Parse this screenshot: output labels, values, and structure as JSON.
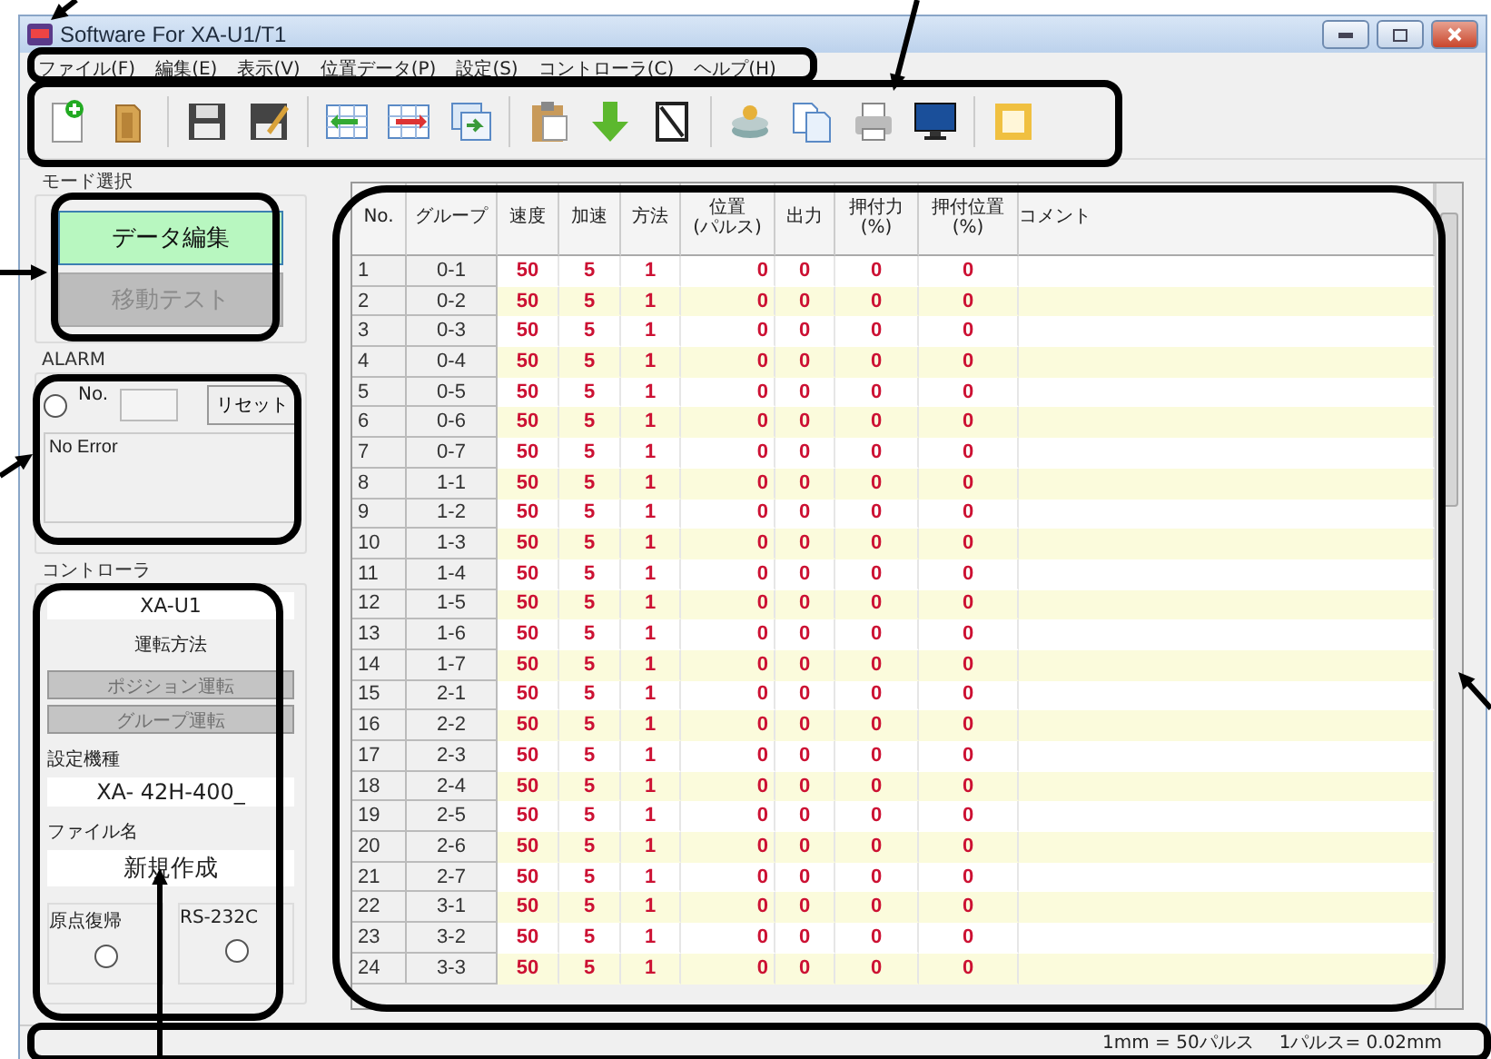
{
  "window": {
    "title": "Software For XA-U1/T1"
  },
  "menu": [
    "ファイル(F)",
    "編集(E)",
    "表示(V)",
    "位置データ(P)",
    "設定(S)",
    "コントローラ(C)",
    "ヘルプ(H)"
  ],
  "mode": {
    "label": "モード選択",
    "buttons": [
      {
        "label": "データ編集",
        "selected": true,
        "disabled": false
      },
      {
        "label": "移動テスト",
        "selected": false,
        "disabled": true
      }
    ]
  },
  "alarm": {
    "label": "ALARM",
    "lamp_on": false,
    "no_label": "No.",
    "reset": "リセット",
    "message": "No Error"
  },
  "controller": {
    "label": "コントローラ",
    "model": "XA-U1",
    "operation_label": "運転方法",
    "operations": [
      {
        "label": "ポジション運転",
        "disabled": true
      },
      {
        "label": "グループ運転",
        "disabled": true
      }
    ],
    "type_label": "設定機種",
    "type_value": "XA- 42H-400_",
    "file_label": "ファイル名",
    "file_value": "新規作成",
    "lamps": [
      {
        "label": "原点復帰",
        "on": false
      },
      {
        "label": "RS-232C",
        "on": false
      }
    ]
  },
  "table": {
    "columns": [
      "No.",
      "グループ",
      "速度",
      "加速",
      "方法",
      "位置\n(パルス)",
      "出力",
      "押付力\n(%)",
      "押付位置\n(%)",
      "コメント"
    ],
    "rows": [
      [
        "1",
        "0-1",
        "50",
        "5",
        "1",
        "0",
        "0",
        "0",
        "0"
      ],
      [
        "2",
        "0-2",
        "50",
        "5",
        "1",
        "0",
        "0",
        "0",
        "0"
      ],
      [
        "3",
        "0-3",
        "50",
        "5",
        "1",
        "0",
        "0",
        "0",
        "0"
      ],
      [
        "4",
        "0-4",
        "50",
        "5",
        "1",
        "0",
        "0",
        "0",
        "0"
      ],
      [
        "5",
        "0-5",
        "50",
        "5",
        "1",
        "0",
        "0",
        "0",
        "0"
      ],
      [
        "6",
        "0-6",
        "50",
        "5",
        "1",
        "0",
        "0",
        "0",
        "0"
      ],
      [
        "7",
        "0-7",
        "50",
        "5",
        "1",
        "0",
        "0",
        "0",
        "0"
      ],
      [
        "8",
        "1-1",
        "50",
        "5",
        "1",
        "0",
        "0",
        "0",
        "0"
      ],
      [
        "9",
        "1-2",
        "50",
        "5",
        "1",
        "0",
        "0",
        "0",
        "0"
      ],
      [
        "10",
        "1-3",
        "50",
        "5",
        "1",
        "0",
        "0",
        "0",
        "0"
      ],
      [
        "11",
        "1-4",
        "50",
        "5",
        "1",
        "0",
        "0",
        "0",
        "0"
      ],
      [
        "12",
        "1-5",
        "50",
        "5",
        "1",
        "0",
        "0",
        "0",
        "0"
      ],
      [
        "13",
        "1-6",
        "50",
        "5",
        "1",
        "0",
        "0",
        "0",
        "0"
      ],
      [
        "14",
        "1-7",
        "50",
        "5",
        "1",
        "0",
        "0",
        "0",
        "0"
      ],
      [
        "15",
        "2-1",
        "50",
        "5",
        "1",
        "0",
        "0",
        "0",
        "0"
      ],
      [
        "16",
        "2-2",
        "50",
        "5",
        "1",
        "0",
        "0",
        "0",
        "0"
      ],
      [
        "17",
        "2-3",
        "50",
        "5",
        "1",
        "0",
        "0",
        "0",
        "0"
      ],
      [
        "18",
        "2-4",
        "50",
        "5",
        "1",
        "0",
        "0",
        "0",
        "0"
      ],
      [
        "19",
        "2-5",
        "50",
        "5",
        "1",
        "0",
        "0",
        "0",
        "0"
      ],
      [
        "20",
        "2-6",
        "50",
        "5",
        "1",
        "0",
        "0",
        "0",
        "0"
      ],
      [
        "21",
        "2-7",
        "50",
        "5",
        "1",
        "0",
        "0",
        "0",
        "0"
      ],
      [
        "22",
        "3-1",
        "50",
        "5",
        "1",
        "0",
        "0",
        "0",
        "0"
      ],
      [
        "23",
        "3-2",
        "50",
        "5",
        "1",
        "0",
        "0",
        "0",
        "0"
      ],
      [
        "24",
        "3-3",
        "50",
        "5",
        "1",
        "0",
        "0",
        "0",
        "0"
      ]
    ]
  },
  "status_bar": [
    "1mm = 50パルス",
    "1パルス= 0.02mm"
  ]
}
